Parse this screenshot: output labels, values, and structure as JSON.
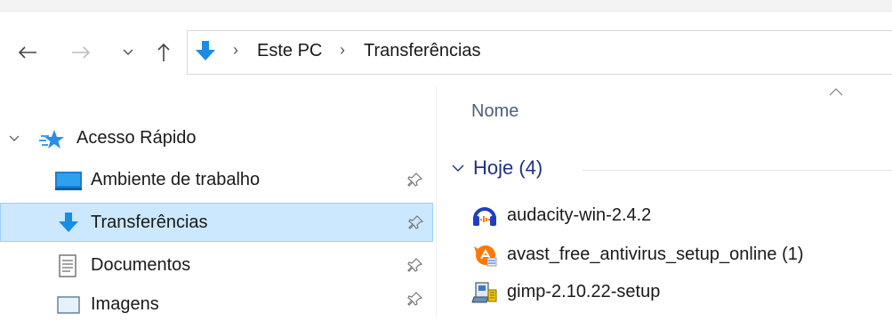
{
  "breadcrumb": [
    "Este PC",
    "Transferências"
  ],
  "nav_pane": {
    "quick_access": "Acesso Rápido",
    "items": [
      {
        "label": "Ambiente de trabalho",
        "icon": "desktop-icon",
        "pinned": true
      },
      {
        "label": "Transferências",
        "icon": "downloads-icon",
        "pinned": true,
        "selected": true
      },
      {
        "label": "Documentos",
        "icon": "documents-icon",
        "pinned": true
      },
      {
        "label": "Imagens",
        "icon": "pictures-icon",
        "pinned": true
      }
    ]
  },
  "content": {
    "column_header": "Nome",
    "group": {
      "label": "Hoje (4)"
    },
    "files": [
      {
        "name": "audacity-win-2.4.2",
        "icon": "audacity-icon"
      },
      {
        "name": "avast_free_antivirus_setup_online (1)",
        "icon": "avast-icon"
      },
      {
        "name": "gimp-2.10.22-setup",
        "icon": "installer-icon"
      }
    ]
  },
  "colors": {
    "accent": "#1e3287",
    "selection": "#cce8ff",
    "selection_border": "#99d1ff",
    "folder_blue": "#1a8ce6"
  }
}
